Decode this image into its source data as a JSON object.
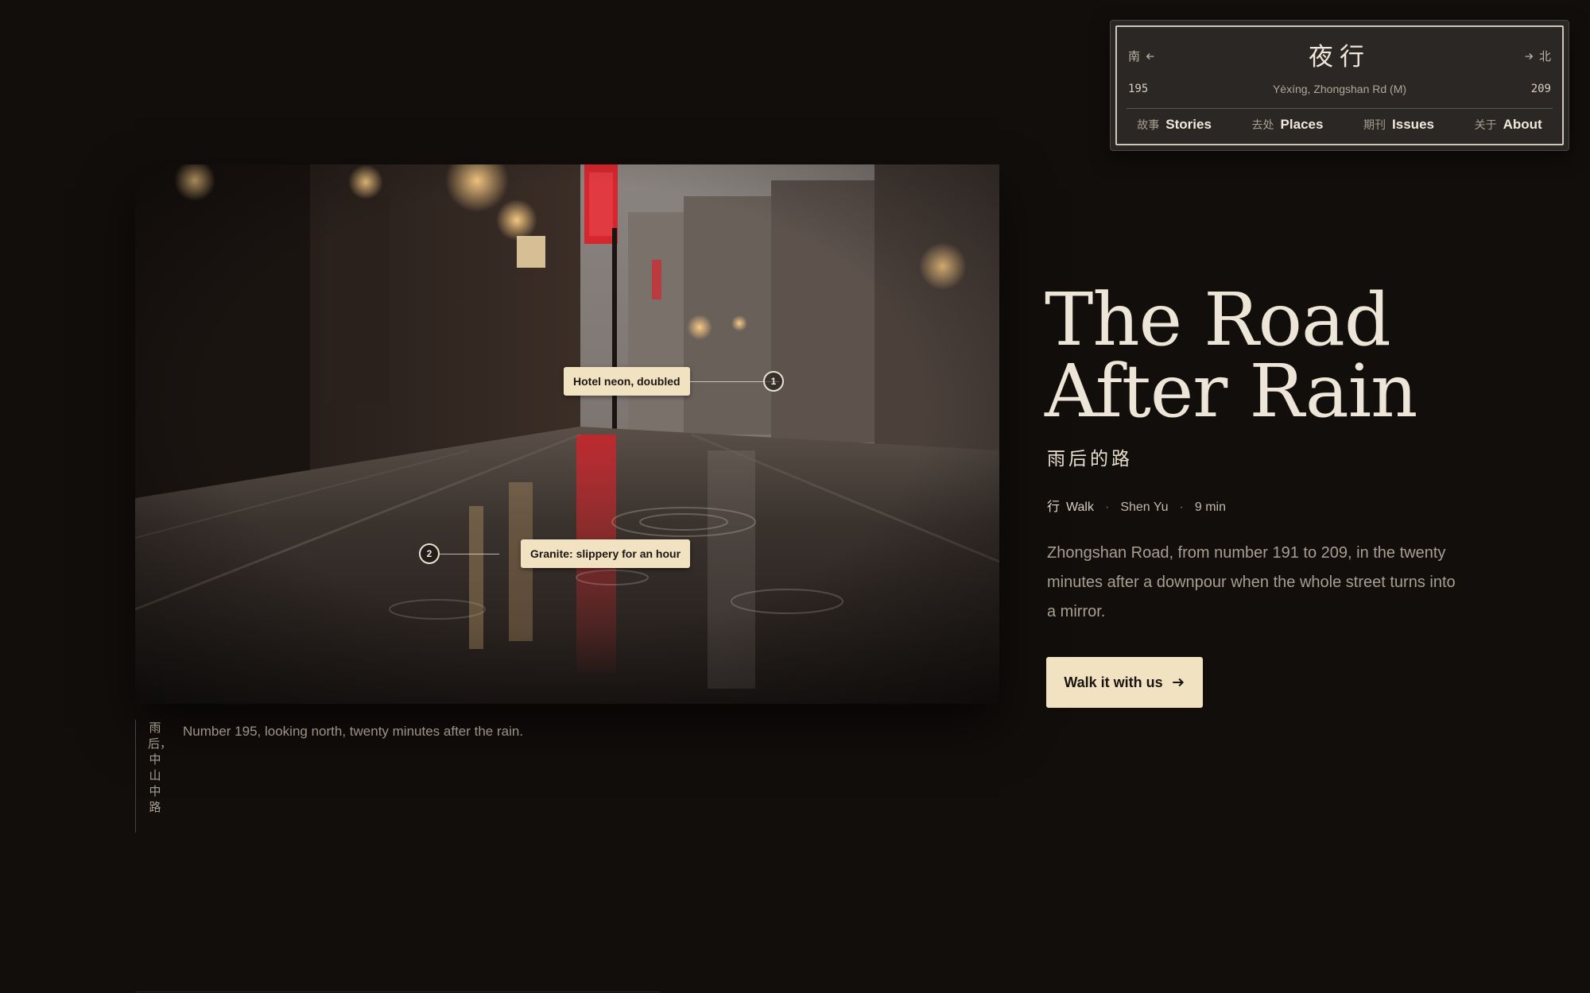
{
  "sign": {
    "title": "夜行",
    "south_label": "南",
    "north_label": "北",
    "number_start": "195",
    "number_end": "209",
    "subtitle": "Yèxíng, Zhongshan Rd (M)",
    "nav": [
      {
        "zh": "故事",
        "en": "Stories"
      },
      {
        "zh": "去处",
        "en": "Places"
      },
      {
        "zh": "期刊",
        "en": "Issues"
      },
      {
        "zh": "关于",
        "en": "About"
      }
    ]
  },
  "photo": {
    "callouts": [
      {
        "number": "1",
        "label": "Hotel neon, doubled"
      },
      {
        "number": "2",
        "label": "Granite: slippery for an hour"
      }
    ]
  },
  "caption": {
    "zh": "雨后，中山中路",
    "en": "Number 195, looking north, twenty minutes after the rain."
  },
  "article": {
    "title_line1": "The Road",
    "title_line2": "After Rain",
    "subtitle_zh": "雨后的路",
    "meta": {
      "category_zh": "行",
      "category": "Walk",
      "author": "Shen Yu",
      "read_time": "9 min",
      "separator": "·"
    },
    "lede": "Zhongshan Road, from number 191 to 209, in the twenty minutes after a downpour when the whole street turns into a mirror.",
    "cta_label": "Walk it with us"
  },
  "colors": {
    "background": "#120e0c",
    "cream": "#f1e3c2",
    "neon_red": "#d7262e",
    "text": "#ede5d7"
  },
  "icons": [
    "arrow-left-icon",
    "arrow-right-icon"
  ]
}
